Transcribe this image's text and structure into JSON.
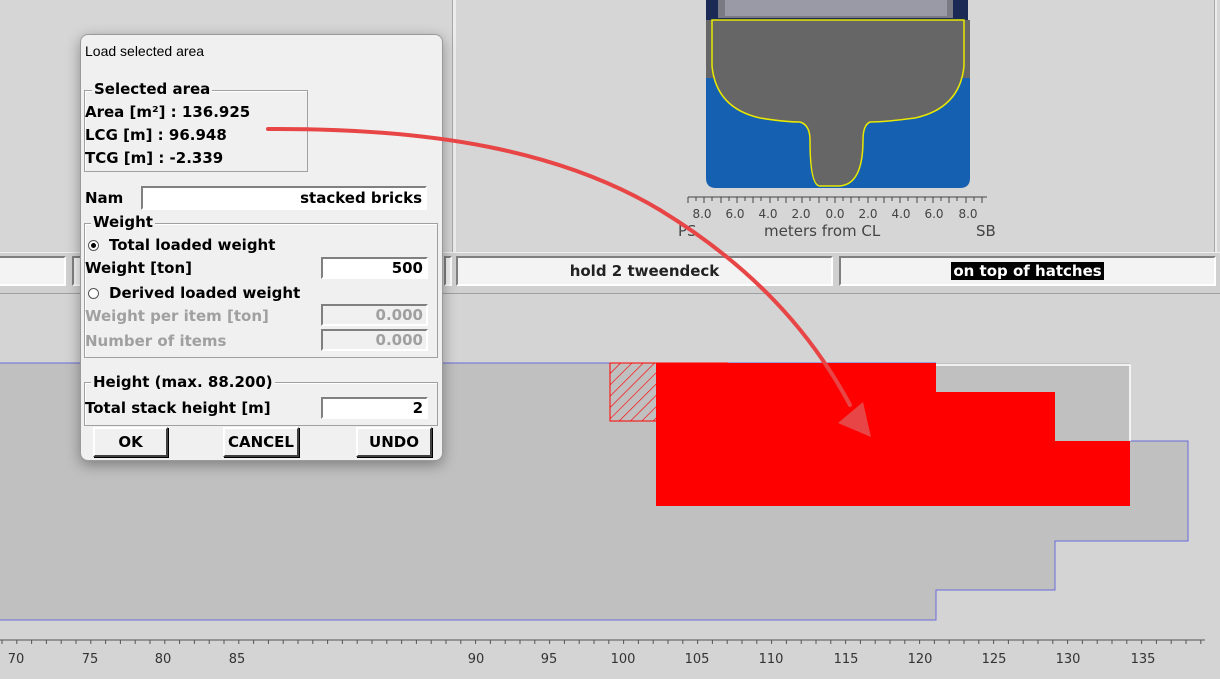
{
  "dialog": {
    "title": "Load selected area",
    "selected_area": {
      "legend": "Selected area",
      "area": "Area [m²] : 136.925",
      "lcg": "LCG [m] : 96.948",
      "tcg": "TCG [m] : -2.339"
    },
    "name_label": "Nam",
    "name_value": "stacked bricks",
    "weight": {
      "legend": "Weight",
      "total_radio_label": "Total loaded weight",
      "total_selected": true,
      "weight_label": "Weight [ton]",
      "weight_value": "500",
      "derived_radio_label": "Derived loaded weight",
      "per_item_label": "Weight per item [ton]",
      "per_item_value": "0.000",
      "items_label": "Number of items",
      "items_value": "0.000"
    },
    "height": {
      "legend": "Height (max. 88.200)",
      "stack_label": "Total stack height [m]",
      "stack_value": "2"
    },
    "buttons": {
      "ok": "OK",
      "cancel": "CANCEL",
      "undo": "UNDO"
    }
  },
  "cross_section": {
    "ticks": [
      "8.0",
      "6.0",
      "4.0",
      "2.0",
      "0.0",
      "2.0",
      "4.0",
      "6.0",
      "8.0"
    ],
    "ps_label": "PS",
    "axis_label": "meters from CL",
    "sb_label": "SB"
  },
  "strip": {
    "hold_label": "hold 2 tweendeck",
    "location_label": "on top of hatches"
  },
  "ruler": {
    "labels": [
      "70",
      "75",
      "80",
      "85",
      "90",
      "95",
      "100",
      "105",
      "110",
      "115",
      "120",
      "125",
      "130",
      "135"
    ]
  },
  "colors": {
    "cargo": "#ff0000",
    "water": "#1560b0",
    "hull": "#666666",
    "hull_outline": "#e8e800",
    "arrow": "#e84646"
  }
}
